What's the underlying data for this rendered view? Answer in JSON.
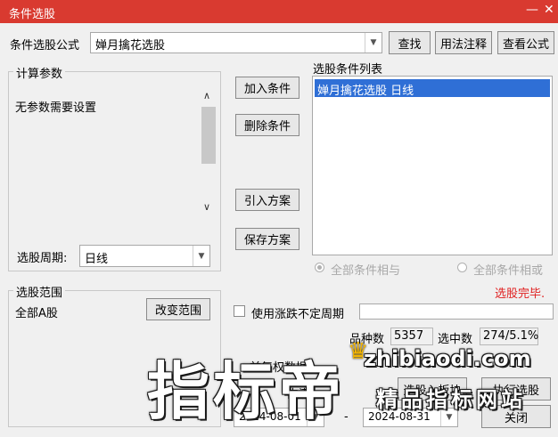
{
  "window": {
    "title": "条件选股",
    "minimize": "—",
    "close": "✕"
  },
  "formula": {
    "label": "条件选股公式",
    "value": "婵月擒花选股",
    "search_btn": "查找",
    "usage_btn": "用法注释",
    "view_btn": "查看公式"
  },
  "params": {
    "title": "计算参数",
    "text": "无参数需要设置",
    "period_label": "选股周期:",
    "period_value": "日线"
  },
  "actions": {
    "add": "加入条件",
    "delete": "删除条件",
    "import": "引入方案",
    "save": "保存方案"
  },
  "condition_list": {
    "title": "选股条件列表",
    "items": [
      "婵月擒花选股  日线"
    ]
  },
  "logic": {
    "and_label": "全部条件相与",
    "or_label": "全部条件相或",
    "status": "选股完毕."
  },
  "range": {
    "title": "选股范围",
    "value": "全部A股",
    "change_btn": "改变范围"
  },
  "options": {
    "use_period_label": "使用涨跌不定周期",
    "stock_count_label": "品种数",
    "stock_count": "5357",
    "selected_label": "选中数",
    "selected_value": "274/5.1%",
    "adjust_label": "前复权数据",
    "time_label": "内满",
    "date_from": "2024-08-01",
    "date_sep": "-",
    "date_to": "2024-08-31"
  },
  "bottom_buttons": {
    "to_block": "选股入板块",
    "execute": "执行选股",
    "close": "关闭"
  },
  "watermark": {
    "big": "指标帝",
    "url": "zhibiaodi.com",
    "site": "精品指标网站"
  },
  "colors": {
    "titlebar": "#d93a30",
    "selection": "#2f6fd6",
    "status": "#e02020"
  }
}
